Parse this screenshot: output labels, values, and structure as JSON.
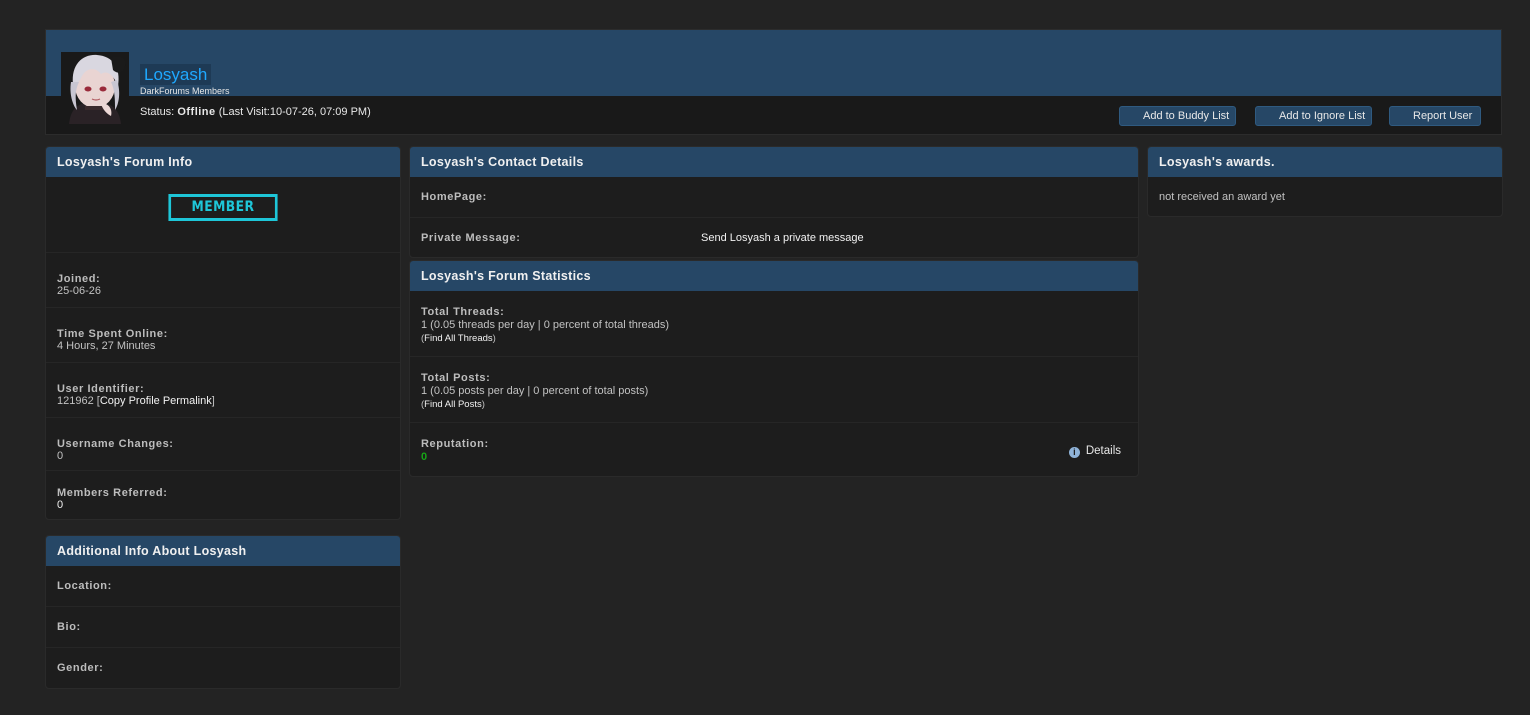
{
  "profile": {
    "username": "Losyash",
    "usertitle": "DarkForums Members",
    "status_label": "Status:",
    "status_value": "Offline",
    "last_visit": "(Last Visit:10-07-26, 07:09 PM)",
    "buttons": {
      "buddy": "Add to Buddy List",
      "ignore": "Add to Ignore List",
      "report": "Report User"
    }
  },
  "forum_info": {
    "title": "Losyash's Forum Info",
    "badge": "MEMBER",
    "joined_label": "Joined:",
    "joined_value": "25-06-26",
    "time_label": "Time Spent Online:",
    "time_value": "4 Hours, 27 Minutes",
    "uid_label": "User Identifier:",
    "uid_value": "121962",
    "uid_link": "Copy Profile Permalink",
    "uname_label": "Username Changes:",
    "uname_value": "0",
    "ref_label": "Members Referred:",
    "ref_value": "0"
  },
  "additional": {
    "title": "Additional Info About Losyash",
    "location_label": "Location:",
    "bio_label": "Bio:",
    "gender_label": "Gender:"
  },
  "contact": {
    "title": "Losyash's Contact Details",
    "homepage_label": "HomePage:",
    "pm_label": "Private Message:",
    "pm_link": "Send Losyash a private message"
  },
  "stats": {
    "title": "Losyash's Forum Statistics",
    "threads_label": "Total Threads:",
    "threads_value": "1 (0.05 threads per day | 0 percent of total threads)",
    "threads_link": "Find All Threads",
    "posts_label": "Total Posts:",
    "posts_value": "1 (0.05 posts per day | 0 percent of total posts)",
    "posts_link": "Find All Posts",
    "rep_label": "Reputation:",
    "rep_value": "0",
    "details": "Details"
  },
  "awards": {
    "title": "Losyash's awards.",
    "empty": "not received an award yet"
  },
  "colors": {
    "header_blue": "#264766",
    "username_blue": "#1fa8ff",
    "badge_cyan": "#1ec6d8",
    "reputation_green": "#17a317"
  }
}
